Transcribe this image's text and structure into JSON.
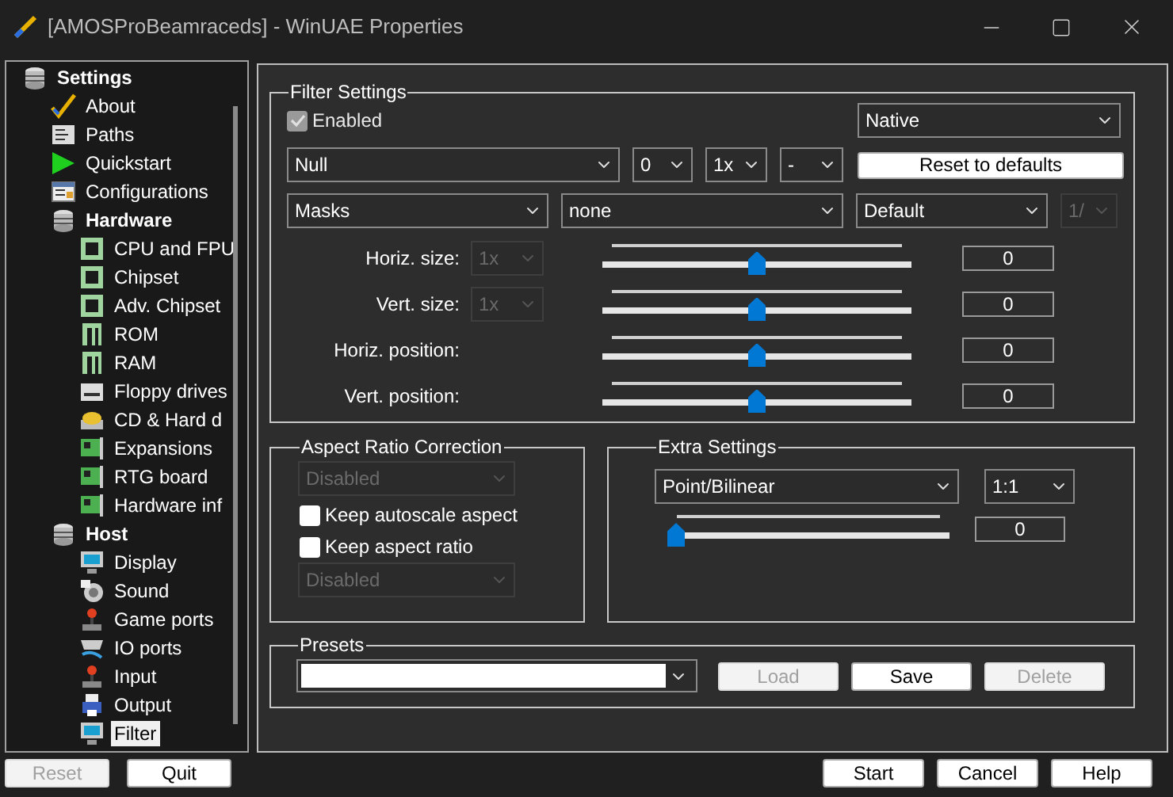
{
  "window": {
    "title": "[AMOSProBeamraceds] - WinUAE Properties"
  },
  "tree": [
    {
      "label": "Settings",
      "kind": "group",
      "selected": false,
      "children": [
        {
          "label": "About",
          "kind": "item",
          "selected": false
        },
        {
          "label": "Paths",
          "kind": "item",
          "selected": false
        },
        {
          "label": "Quickstart",
          "kind": "item",
          "selected": false
        },
        {
          "label": "Configurations",
          "kind": "item",
          "selected": false
        },
        {
          "label": "Hardware",
          "kind": "group",
          "selected": false,
          "children": [
            {
              "label": "CPU and FPU",
              "kind": "item",
              "selected": false
            },
            {
              "label": "Chipset",
              "kind": "item",
              "selected": false
            },
            {
              "label": "Adv. Chipset",
              "kind": "item",
              "selected": false
            },
            {
              "label": "ROM",
              "kind": "item",
              "selected": false
            },
            {
              "label": "RAM",
              "kind": "item",
              "selected": false
            },
            {
              "label": "Floppy drives",
              "kind": "item",
              "selected": false
            },
            {
              "label": "CD & Hard d",
              "kind": "item",
              "selected": false
            },
            {
              "label": "Expansions",
              "kind": "item",
              "selected": false
            },
            {
              "label": "RTG board",
              "kind": "item",
              "selected": false
            },
            {
              "label": "Hardware inf",
              "kind": "item",
              "selected": false
            }
          ]
        },
        {
          "label": "Host",
          "kind": "group",
          "selected": false,
          "children": [
            {
              "label": "Display",
              "kind": "item",
              "selected": false
            },
            {
              "label": "Sound",
              "kind": "item",
              "selected": false
            },
            {
              "label": "Game ports",
              "kind": "item",
              "selected": false
            },
            {
              "label": "IO ports",
              "kind": "item",
              "selected": false
            },
            {
              "label": "Input",
              "kind": "item",
              "selected": false
            },
            {
              "label": "Output",
              "kind": "item",
              "selected": false
            },
            {
              "label": "Filter",
              "kind": "item",
              "selected": true
            }
          ]
        }
      ]
    }
  ],
  "tree_buttons": [
    {
      "label": "Reset",
      "disabled": true
    },
    {
      "label": "Quit",
      "disabled": false
    }
  ],
  "filter_settings": {
    "title": "Filter Settings",
    "enabled": {
      "label": "Enabled",
      "checked": true,
      "disabled": true
    },
    "mode": "Native",
    "reset_button": "Reset to defaults",
    "row1": [
      "Null",
      "0",
      "1x",
      "-"
    ],
    "row2": [
      {
        "value": "Masks",
        "disabled": false
      },
      {
        "value": "none",
        "disabled": false
      },
      {
        "value": "Default",
        "disabled": false
      },
      {
        "value": "1/",
        "disabled": true
      }
    ],
    "sliders": [
      {
        "label": "Horiz. size:",
        "select": {
          "value": "1x",
          "disabled": true
        },
        "level": 0.5,
        "value": "0"
      },
      {
        "label": "Vert. size:",
        "select": {
          "value": "1x",
          "disabled": true
        },
        "level": 0.5,
        "value": "0"
      },
      {
        "label": "Horiz. position:",
        "level": 0.5,
        "value": "0"
      },
      {
        "label": "Vert. position:",
        "level": 0.5,
        "value": "0"
      }
    ]
  },
  "aspect": {
    "title": "Aspect Ratio Correction",
    "items": [
      {
        "kind": "select",
        "value": "Disabled",
        "disabled": true
      },
      {
        "kind": "checkbox",
        "label": "Keep autoscale aspect",
        "checked": false
      },
      {
        "kind": "checkbox",
        "label": "Keep aspect ratio",
        "checked": false
      },
      {
        "kind": "select",
        "value": "Disabled",
        "disabled": true
      }
    ]
  },
  "extra": {
    "title": "Extra Settings",
    "filter": "Point/Bilinear",
    "scale": "1:1",
    "slider": {
      "level": 0,
      "value": "0"
    }
  },
  "presets": {
    "title": "Presets",
    "buttons": [
      {
        "label": "Load",
        "disabled": true
      },
      {
        "label": "Save",
        "disabled": false
      },
      {
        "label": "Delete",
        "disabled": true
      }
    ]
  },
  "footer_buttons": [
    {
      "label": "Start",
      "disabled": false
    },
    {
      "label": "Cancel",
      "disabled": false
    },
    {
      "label": "Help",
      "disabled": false
    }
  ]
}
